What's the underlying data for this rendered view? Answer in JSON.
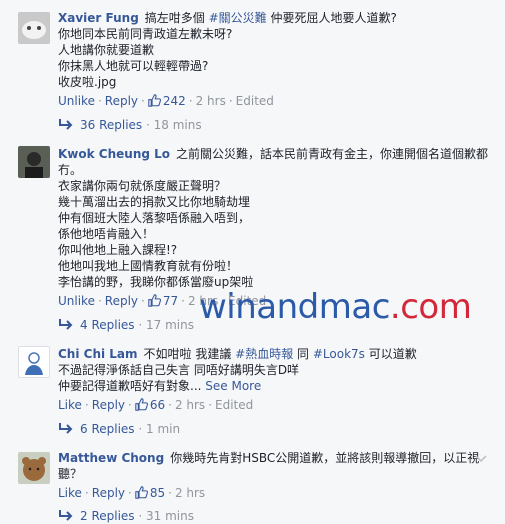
{
  "comments": [
    {
      "name": "Xavier Fung",
      "text_lines": [
        {
          "pre": "搞左咁多個 ",
          "tag": "#關公災難",
          "post": " 仲要死屈人地要人道歉?"
        },
        {
          "pre": "你地同本民前同青政道左歉未呀?",
          "tag": "",
          "post": ""
        },
        {
          "pre": "人地講你就要道歉",
          "tag": "",
          "post": ""
        },
        {
          "pre": "你抹黑人地就可以輕輕帶過?",
          "tag": "",
          "post": ""
        },
        {
          "pre": "收皮啦.jpg",
          "tag": "",
          "post": ""
        }
      ],
      "action_primary": "Unlike",
      "reply_label": "Reply",
      "likes": "242",
      "time": "2 hrs",
      "edited": "Edited",
      "replies_label": "36 Replies",
      "replies_time": "18 mins"
    },
    {
      "name": "Kwok Cheung Lo",
      "text_lines": [
        {
          "pre": "之前關公災難，話本民前青政有金主，你連開個名道個歉都",
          "tag": "",
          "post": ""
        },
        {
          "pre": "冇。",
          "tag": "",
          "post": ""
        },
        {
          "pre": "衣家講你兩句就係度嚴正聲明？",
          "tag": "",
          "post": ""
        },
        {
          "pre": "幾十萬溜出去的捐款又比你地騎劫埋",
          "tag": "",
          "post": ""
        },
        {
          "pre": "仲有個班大陸人落黎唔係融入唔到，",
          "tag": "",
          "post": ""
        },
        {
          "pre": "係他地唔肯融入！",
          "tag": "",
          "post": ""
        },
        {
          "pre": "你叫他地上融入課程!?",
          "tag": "",
          "post": ""
        },
        {
          "pre": "他地叫我地上國情教育就有份啦！",
          "tag": "",
          "post": ""
        },
        {
          "pre": "李怡講的野，我睇你都係當廢up架啦",
          "tag": "",
          "post": ""
        }
      ],
      "action_primary": "Unlike",
      "reply_label": "Reply",
      "likes": "77",
      "time": "2 hrs",
      "edited": "Edited",
      "replies_label": "4 Replies",
      "replies_time": "17 mins"
    },
    {
      "name": "Chi Chi Lam",
      "text_lines": [
        {
          "pre": "不如咁啦 我建議 ",
          "tag": "#熱血時報",
          "post": " 同 "
        },
        {
          "pre": "不過記得淨係話自己失言 同唔好講明失言D咩",
          "tag": "",
          "post": ""
        },
        {
          "pre": "仲要記得道歉唔好有對象...",
          "tag": "",
          "post": ""
        }
      ],
      "line1_tag2": "#Look7s",
      "line1_tail": " 可以道歉",
      "see_more": "See More",
      "action_primary": "Like",
      "reply_label": "Reply",
      "likes": "66",
      "time": "2 hrs",
      "edited": "Edited",
      "replies_label": "6 Replies",
      "replies_time": "1 min"
    },
    {
      "name": "Matthew Chong",
      "text_lines": [
        {
          "pre": "你幾時先肯對HSBC公開道歉，並將該則報導撤回，以正視",
          "tag": "",
          "post": ""
        },
        {
          "pre": "聽？",
          "tag": "",
          "post": ""
        }
      ],
      "action_primary": "Like",
      "reply_label": "Reply",
      "likes": "85",
      "time": "2 hrs",
      "replies_label": "2 Replies",
      "replies_time": "31 mins"
    }
  ],
  "watermark": {
    "part1": "winandmac",
    "part2": ".com"
  },
  "colors": {
    "link": "#365899",
    "meta": "#90949c",
    "text": "#1d2129",
    "background": "#f6f7f9"
  }
}
